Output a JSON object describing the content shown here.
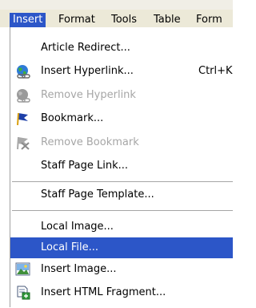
{
  "menubar": {
    "items": [
      {
        "label": "Insert"
      },
      {
        "label": "Format"
      },
      {
        "label": "Tools"
      },
      {
        "label": "Table"
      },
      {
        "label": "Form"
      }
    ],
    "active": "Insert"
  },
  "menu": {
    "items": [
      {
        "label": "Article Redirect...",
        "enabled": true
      },
      {
        "label": "Insert Hyperlink...",
        "shortcut": "Ctrl+K",
        "icon": "globe-link-icon",
        "enabled": true
      },
      {
        "label": "Remove Hyperlink",
        "icon": "remove-hyperlink-icon",
        "enabled": false
      },
      {
        "label": "Bookmark...",
        "icon": "bookmark-flag-icon",
        "enabled": true
      },
      {
        "label": "Remove Bookmark",
        "icon": "remove-bookmark-icon",
        "enabled": false
      },
      {
        "label": "Staff Page Link...",
        "enabled": true
      },
      {
        "label": "Staff Page Template...",
        "enabled": true
      },
      {
        "label": "Local Image...",
        "enabled": true
      },
      {
        "label": "Local File...",
        "enabled": true,
        "highlighted": true
      },
      {
        "label": "Insert Image...",
        "icon": "image-icon",
        "enabled": true
      },
      {
        "label": "Insert HTML Fragment...",
        "icon": "html-fragment-icon",
        "enabled": true
      }
    ]
  },
  "colors": {
    "highlight": "#2c56c8",
    "menubar_bg": "#ece9d8",
    "disabled_text": "#a6a6a6"
  }
}
